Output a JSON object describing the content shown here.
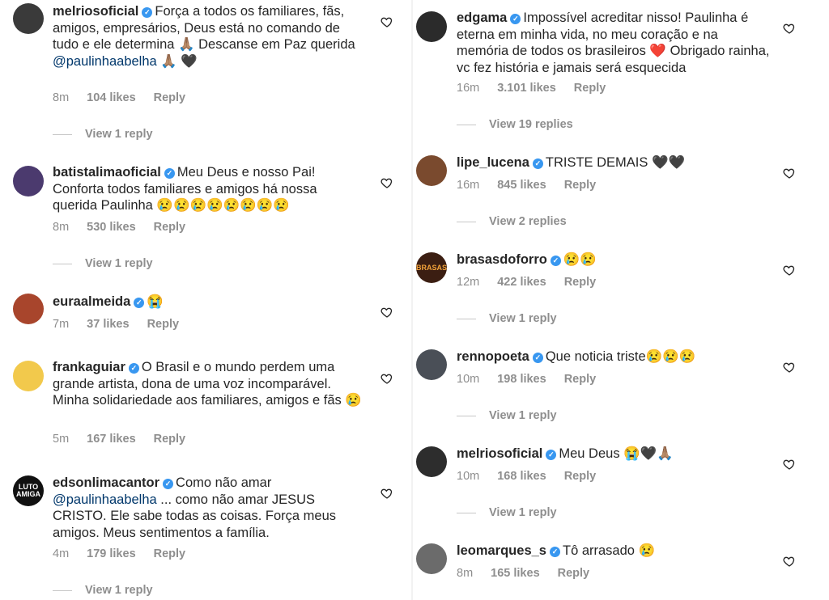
{
  "left": [
    {
      "user": "melriosofficial_placeholder",
      "username": "melriosoficial",
      "text": "Força a todos os familiares, fãs, amigos, empresários, Deus está no comando de tudo e ele determina 🙏🏽 Descanse em Paz querida",
      "mention": "@paulinhaabelha",
      "trail": " 🙏🏽 🖤",
      "time": "8m",
      "likes": "104 likes",
      "reply": "Reply",
      "view": "View 1 reply",
      "avatar_color": "#3a3a3a"
    },
    {
      "username": "batistalimaoficial",
      "text": "Meu Deus e nosso Pai! Conforta todos familiares e amigos há nossa querida Paulinha 😢😢😢😢😢😢😢😢",
      "time": "8m",
      "likes": "530 likes",
      "reply": "Reply",
      "view": "View 1 reply",
      "avatar_color": "#4b3a6e"
    },
    {
      "username": "euraalmeida",
      "text": "😭",
      "time": "7m",
      "likes": "37 likes",
      "reply": "Reply",
      "avatar_color": "#a8452c"
    },
    {
      "username": "frankaguiar",
      "text": "O Brasil e o mundo perdem uma grande artista, dona de uma voz incomparável. Minha solidariedade aos familiares, amigos e fãs 😢",
      "time": "5m",
      "likes": "167 likes",
      "reply": "Reply",
      "avatar_color": "#f2c94c"
    },
    {
      "username": "edsonlimacantor",
      "text_prefix": "Como não amar",
      "mention": "@paulinhaabelha",
      "text": "... como não amar JESUS CRISTO. Ele sabe todas as coisas. Força meus amigos. Meus sentimentos a família.",
      "time": "4m",
      "likes": "179 likes",
      "reply": "Reply",
      "view": "View 1 reply",
      "avatar_text": "LUTO AMIGA",
      "avatar_color": "#111111"
    }
  ],
  "right": [
    {
      "username": "edgama",
      "text": "Impossível acreditar nisso! Paulinha é eterna em minha vida, no meu coração e na memória de todos os brasileiros ❤️ Obrigado rainha, vc fez história e jamais será esquecida",
      "time": "16m",
      "likes": "3.101 likes",
      "reply": "Reply",
      "view": "View 19 replies",
      "avatar_color": "#2b2b2b"
    },
    {
      "username": "lipe_lucena",
      "text": "TRISTE DEMAIS 🖤🖤",
      "time": "16m",
      "likes": "845 likes",
      "reply": "Reply",
      "view": "View 2 replies",
      "avatar_color": "#7a4a2e"
    },
    {
      "username": "brasasdoforro",
      "text": "😢😢",
      "time": "12m",
      "likes": "422 likes",
      "reply": "Reply",
      "view": "View 1 reply",
      "avatar_text": "BRASAS",
      "avatar_color": "#3b1e12"
    },
    {
      "username": "rennopoeta",
      "text": "Que noticia triste😢😢😢",
      "time": "10m",
      "likes": "198 likes",
      "reply": "Reply",
      "view": "View 1 reply",
      "avatar_color": "#4a4f57"
    },
    {
      "username": "melriosoficial",
      "text": "Meu Deus 😭🖤🙏🏽",
      "time": "10m",
      "likes": "168 likes",
      "reply": "Reply",
      "view": "View 1 reply",
      "avatar_color": "#2d2d2d"
    },
    {
      "username": "leomarques_s",
      "text": "Tô arrasado 😢",
      "time": "8m",
      "likes": "165 likes",
      "reply": "Reply",
      "avatar_color": "#6b6b6b"
    }
  ],
  "colors": {
    "verified": "#3897f0",
    "mention": "#00376b",
    "meta": "#8e8e8e"
  },
  "icons": {
    "verified": "verified-badge-icon",
    "like": "heart-outline-icon"
  }
}
